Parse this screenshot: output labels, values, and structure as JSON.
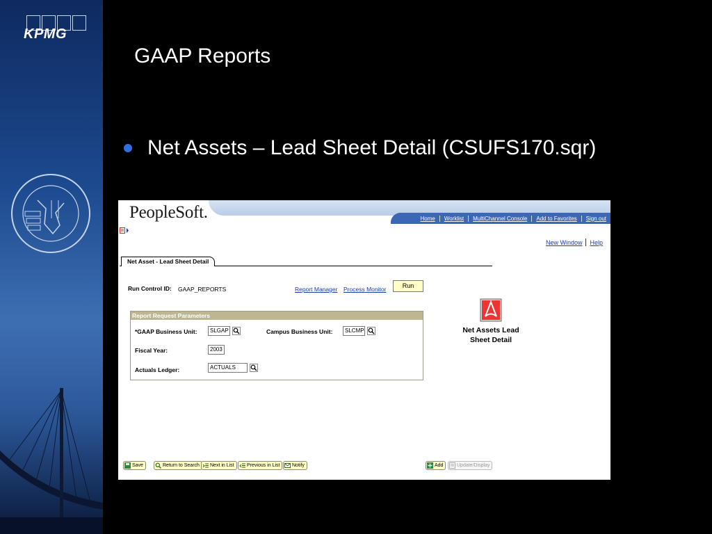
{
  "slide": {
    "logo_text": "KPMG",
    "title": "GAAP Reports",
    "bullet": "Net Assets – Lead Sheet Detail (CSUFS170.sqr)"
  },
  "colors": {
    "accent_blue": "#2e6fe0",
    "ps_link": "#1b3ba8",
    "ps_button_bg": "#ffffc6",
    "ps_group_header": "#bdb690"
  },
  "peoplesoft": {
    "logo": "PeopleSoft.",
    "header_links": [
      "Home",
      "Worklist",
      "MultiChannel Console",
      "Add to Favorites",
      "Sign out"
    ],
    "top_links": {
      "new_window": "New Window",
      "help": "Help"
    },
    "tab_label": "Net Asset - Lead Sheet Detail",
    "run_control": {
      "label": "Run Control ID:",
      "value": "GAAP_REPORTS",
      "report_manager": "Report Manager",
      "process_monitor": "Process Monitor",
      "run_button": "Run"
    },
    "params": {
      "title": "Report Request Parameters",
      "gaap_bu_label": "*GAAP Business Unit:",
      "gaap_bu_value": "SLGAP",
      "campus_bu_label": "Campus Business Unit:",
      "campus_bu_value": "SLCMP",
      "fiscal_year_label": "Fiscal Year:",
      "fiscal_year_value": "2003",
      "actuals_ledger_label": "Actuals Ledger:",
      "actuals_ledger_value": "ACTUALS"
    },
    "report_caption_line1": "Net Assets Lead",
    "report_caption_line2": "Sheet Detail",
    "buttons": {
      "save": "Save",
      "return_to_search": "Return to Search",
      "next_in_list": "Next in List",
      "previous_in_list": "Previous in List",
      "notify": "Notify",
      "add": "Add",
      "update_display": "Update/Display"
    }
  }
}
